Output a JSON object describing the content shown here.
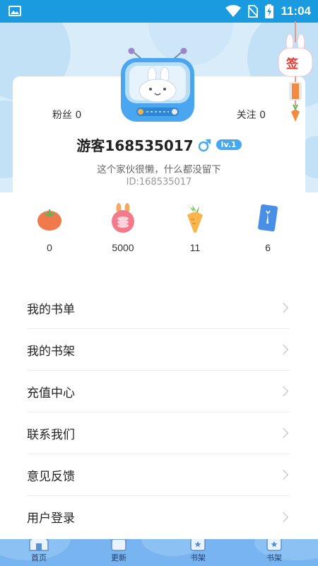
{
  "status_bar": {
    "time": "11:04",
    "icons": [
      "gallery-icon",
      "wifi-icon",
      "no-sim-icon",
      "battery-charging-icon"
    ]
  },
  "sign_in": {
    "label": "签"
  },
  "profile": {
    "fans_label": "粉丝 0",
    "follow_label": "关注 0",
    "username": "游客168535017",
    "gender": "male",
    "level": "lv.1",
    "bio": "这个家伙很懒，什么都没留下",
    "user_id": "ID:168535017"
  },
  "stats": [
    {
      "icon": "tomato-icon",
      "value": "0",
      "color": "#f07a4c"
    },
    {
      "icon": "coin-jar-icon",
      "value": "5000",
      "color": "#f37a8a"
    },
    {
      "icon": "carrot-icon",
      "value": "11",
      "color": "#f8b64c"
    },
    {
      "icon": "card-icon",
      "value": "6",
      "color": "#4a8fe6"
    }
  ],
  "menu": [
    {
      "label": "我的书单"
    },
    {
      "label": "我的书架"
    },
    {
      "label": "充值中心"
    },
    {
      "label": "联系我们"
    },
    {
      "label": "意见反馈"
    },
    {
      "label": "用户登录"
    }
  ],
  "bottom_nav": [
    {
      "label": "首页",
      "icon": "home-icon"
    },
    {
      "label": "更新",
      "icon": "update-icon"
    },
    {
      "label": "书架",
      "icon": "bookshelf-icon"
    },
    {
      "label": "书架",
      "icon": "bookshelf-icon"
    }
  ],
  "colors": {
    "status_bar": "#1a9be0",
    "header_bg": "#d8ecfa",
    "accent": "#46a8ef",
    "nav_bg": "#78b4f0"
  }
}
